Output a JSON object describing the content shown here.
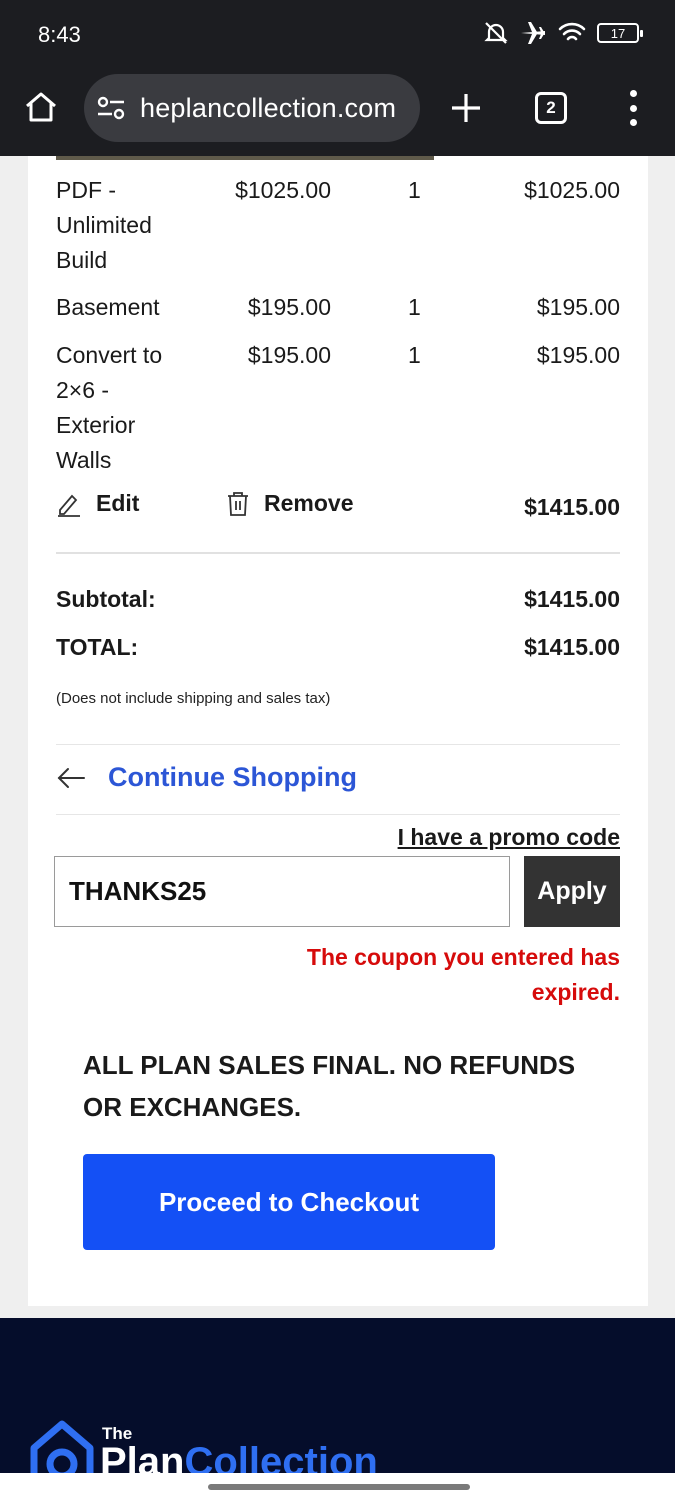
{
  "status_bar": {
    "time": "8:43",
    "battery": "17"
  },
  "browser": {
    "url": "heplancollection.com",
    "tab_count": "2"
  },
  "cart": {
    "items": [
      {
        "name_lines": [
          "PDF -",
          "Unlimited",
          "Build"
        ],
        "price": "$1025.00",
        "qty": "1",
        "total": "$1025.00"
      },
      {
        "name_lines": [
          "Basement"
        ],
        "price": "$195.00",
        "qty": "1",
        "total": "$195.00"
      },
      {
        "name_lines": [
          "Convert to",
          "2×6 -",
          "Exterior",
          "Walls"
        ],
        "price": "$195.00",
        "qty": "1",
        "total": "$195.00"
      }
    ],
    "edit_label": "Edit",
    "remove_label": "Remove",
    "line_total": "$1415.00",
    "subtotal_label": "Subtotal:",
    "subtotal_value": "$1415.00",
    "total_label": "TOTAL:",
    "total_value": "$1415.00",
    "note": "(Does not include shipping and sales tax)",
    "continue_label": "Continue Shopping",
    "promo_link": "I have a promo code",
    "promo_value": "THANKS25",
    "apply_label": "Apply",
    "error_line1": "The coupon you entered has",
    "error_line2": "expired.",
    "final_line1": "ALL PLAN SALES FINAL. NO REFUNDS",
    "final_line2": "OR EXCHANGES.",
    "checkout_label": "Proceed to Checkout"
  },
  "footer": {
    "logo_the": "The",
    "logo_word1": "Plan",
    "logo_word2": "Collection"
  },
  "colors": {
    "accent": "#1450f5",
    "link": "#2c56d6",
    "error": "#d60b0b",
    "footer_bg": "#050d2b",
    "chrome_bg": "#1c1d21"
  }
}
